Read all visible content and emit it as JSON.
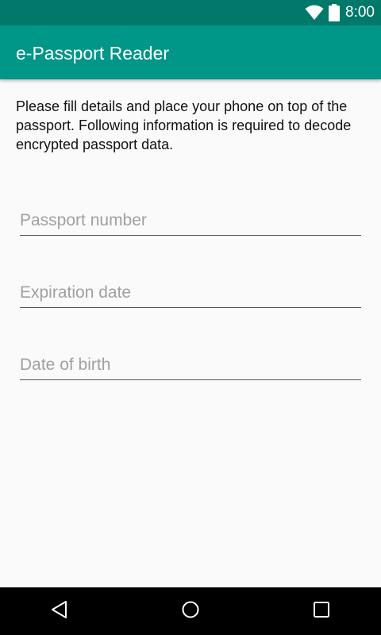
{
  "status_bar": {
    "time": "8:00",
    "icons": [
      "wifi-icon",
      "battery-icon"
    ]
  },
  "app_bar": {
    "title": "e-Passport Reader"
  },
  "main": {
    "instructions": "Please fill details and place your phone on top of the passport. Following information is required to decode encrypted passport data.",
    "fields": [
      {
        "placeholder": "Passport number",
        "value": ""
      },
      {
        "placeholder": "Expiration date",
        "value": ""
      },
      {
        "placeholder": "Date of birth",
        "value": ""
      }
    ]
  },
  "nav_bar": {
    "icons": [
      "back-icon",
      "home-icon",
      "recents-icon"
    ]
  },
  "colors": {
    "status_bar": "#00796b",
    "app_bar": "#009688",
    "background": "#fafafa",
    "nav_bar": "#000000"
  }
}
